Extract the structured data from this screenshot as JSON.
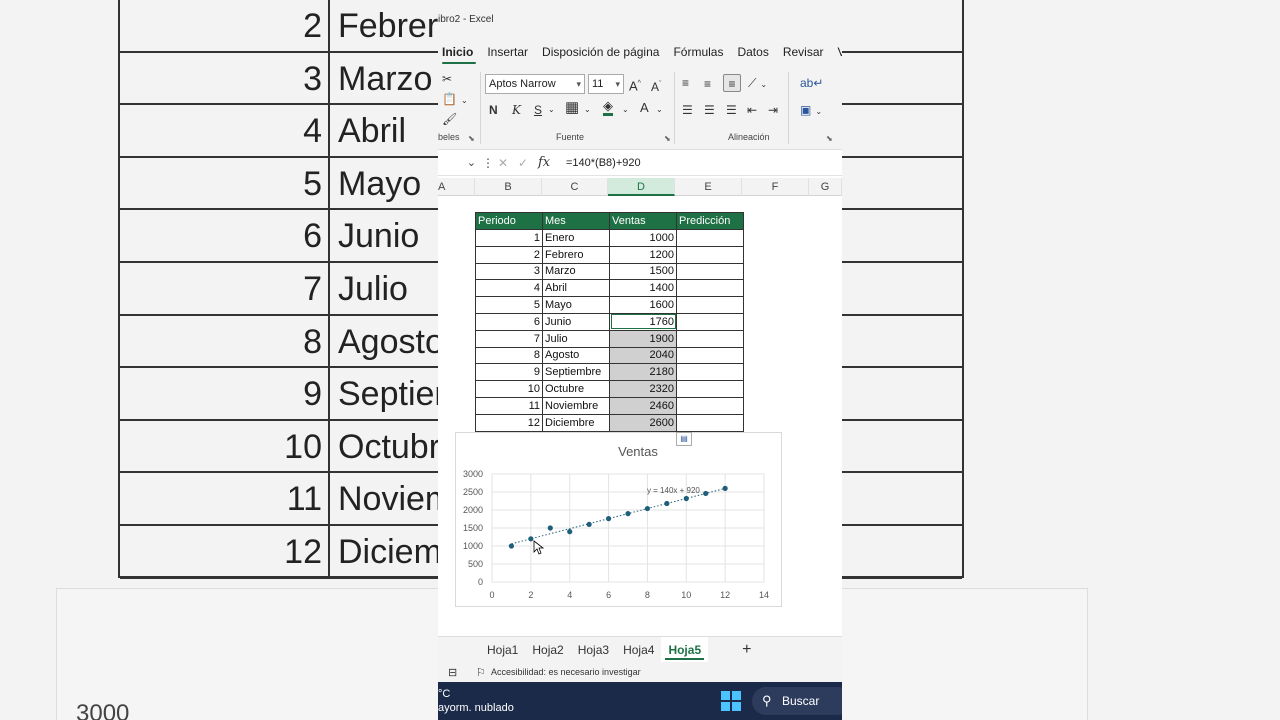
{
  "window": {
    "title": "ibro2  -  Excel"
  },
  "ribbon_tabs": [
    "Inicio",
    "Insertar",
    "Disposición de página",
    "Fórmulas",
    "Datos",
    "Revisar",
    "Vist"
  ],
  "active_tab": "Inicio",
  "ribbon": {
    "font_name": "Aptos Narrow",
    "font_size": "11",
    "bold_label": "N",
    "italic_label": "K",
    "underline_label": "S",
    "clipboard_label": "beles",
    "font_group_label": "Fuente",
    "align_group_label": "Alineación"
  },
  "formula_bar": {
    "fx": "fx",
    "formula": "=140*(B8)+920"
  },
  "columns": [
    "A",
    "B",
    "C",
    "D",
    "E",
    "F",
    "G"
  ],
  "selected_column": "D",
  "table": {
    "headers": [
      "Periodo",
      "Mes",
      "Ventas",
      "Predicción"
    ],
    "rows": [
      {
        "periodo": "1",
        "mes": "Enero",
        "ventas": "1000"
      },
      {
        "periodo": "2",
        "mes": "Febrero",
        "ventas": "1200"
      },
      {
        "periodo": "3",
        "mes": "Marzo",
        "ventas": "1500"
      },
      {
        "periodo": "4",
        "mes": "Abril",
        "ventas": "1400"
      },
      {
        "periodo": "5",
        "mes": "Mayo",
        "ventas": "1600"
      },
      {
        "periodo": "6",
        "mes": "Junio",
        "ventas": "1760"
      },
      {
        "periodo": "7",
        "mes": "Julio",
        "ventas": "1900"
      },
      {
        "periodo": "8",
        "mes": "Agosto",
        "ventas": "2040"
      },
      {
        "periodo": "9",
        "mes": "Septiembre",
        "ventas": "2180"
      },
      {
        "periodo": "10",
        "mes": "Octubre",
        "ventas": "2320"
      },
      {
        "periodo": "11",
        "mes": "Noviembre",
        "ventas": "2460"
      },
      {
        "periodo": "12",
        "mes": "Diciembre",
        "ventas": "2600"
      }
    ]
  },
  "chart_data": {
    "type": "scatter",
    "title": "Ventas",
    "x": [
      1,
      2,
      3,
      4,
      5,
      6,
      7,
      8,
      9,
      10,
      11,
      12
    ],
    "y": [
      1000,
      1200,
      1500,
      1400,
      1600,
      1760,
      1900,
      2040,
      2180,
      2320,
      2460,
      2600
    ],
    "xlim": [
      0,
      14
    ],
    "ylim": [
      0,
      3000
    ],
    "xticks": [
      0,
      2,
      4,
      6,
      8,
      10,
      12,
      14
    ],
    "yticks": [
      0,
      500,
      1000,
      1500,
      2000,
      2500,
      3000
    ],
    "trendline": {
      "slope": 140,
      "intercept": 920,
      "label": "y = 140x + 920"
    },
    "grid": true,
    "marker_color": "#1f5f7a"
  },
  "sheet_tabs": [
    "Hoja1",
    "Hoja2",
    "Hoja3",
    "Hoja4",
    "Hoja5"
  ],
  "active_sheet": "Hoja5",
  "add_sheet": "+",
  "status": {
    "accessibility": "Accesibilidad: es necesario investigar"
  },
  "taskbar": {
    "temp": "°C",
    "weather": "ayorm. nublado",
    "search": "Buscar"
  },
  "background": {
    "rows": [
      {
        "n": "2",
        "mes": "Febrero"
      },
      {
        "n": "3",
        "mes": "Marzo"
      },
      {
        "n": "4",
        "mes": "Abril"
      },
      {
        "n": "5",
        "mes": "Mayo"
      },
      {
        "n": "6",
        "mes": "Junio"
      },
      {
        "n": "7",
        "mes": "Julio"
      },
      {
        "n": "8",
        "mes": "Agosto"
      },
      {
        "n": "9",
        "mes": "Septiembre"
      },
      {
        "n": "10",
        "mes": "Octubre"
      },
      {
        "n": "11",
        "mes": "Noviembre"
      },
      {
        "n": "12",
        "mes": "Diciembre"
      }
    ],
    "chart_label": "3000"
  },
  "colors": {
    "excel_green": "#1e7145",
    "selection_gray": "#d0d0d0",
    "taskbar": "#1b2a48"
  }
}
